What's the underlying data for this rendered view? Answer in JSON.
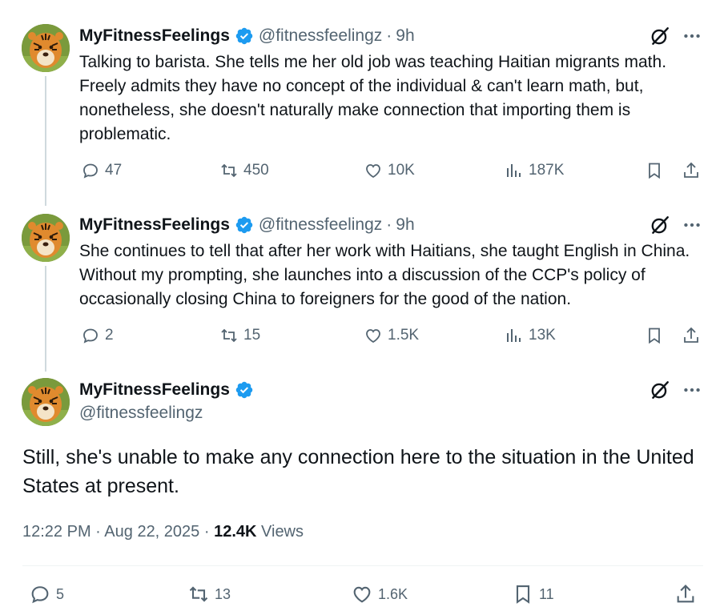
{
  "colors": {
    "verified": "#1d9bf0",
    "secondary_text": "#536471",
    "primary_text": "#0f1419",
    "thread_line": "#cfd9de"
  },
  "tweets": [
    {
      "name": "MyFitnessFeelings",
      "handle": "@fitnessfeelingz",
      "separator": "·",
      "time": "9h",
      "text": "Talking to barista. She tells me her old job was teaching Haitian migrants math. Freely admits they have no concept of the individual & can't learn math, but, nonetheless, she doesn't naturally make connection that importing them is problematic.",
      "replies": "47",
      "reposts": "450",
      "likes": "10K",
      "views": "187K"
    },
    {
      "name": "MyFitnessFeelings",
      "handle": "@fitnessfeelingz",
      "separator": "·",
      "time": "9h",
      "text": "She continues to tell that after her work with Haitians, she taught English in China. Without my prompting, she launches into a discussion of the CCP's policy of occasionally closing China to foreigners for the good of the nation.",
      "replies": "2",
      "reposts": "15",
      "likes": "1.5K",
      "views": "13K"
    }
  ],
  "main_tweet": {
    "name": "MyFitnessFeelings",
    "handle": "@fitnessfeelingz",
    "text": "Still, she's unable to make any connection here to the situation in the United States at present.",
    "time": "12:22 PM",
    "date": "Aug 22, 2025",
    "views_count": "12.4K",
    "views_label": "Views",
    "replies": "5",
    "reposts": "13",
    "likes": "1.6K",
    "bookmarks": "11"
  },
  "icons": [
    "verified-badge-icon",
    "grok-icon",
    "more-icon",
    "reply-icon",
    "repost-icon",
    "like-icon",
    "views-icon",
    "bookmark-icon",
    "share-icon"
  ]
}
